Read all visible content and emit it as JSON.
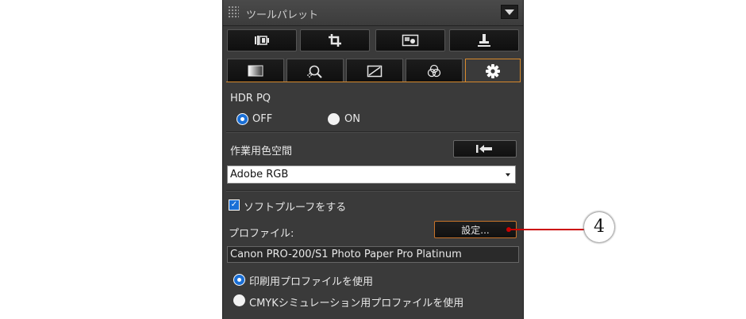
{
  "panel": {
    "title": "ツールパレット"
  },
  "toolbar": {
    "icons": [
      "lens-correction-icon",
      "crop-icon",
      "image-icon",
      "stamp-icon"
    ]
  },
  "tabs": {
    "icons": [
      "basic-adjust-icon",
      "noise-sharpness-icon",
      "tone-curve-icon",
      "color-adjust-icon",
      "settings-gear-icon"
    ],
    "active": 4
  },
  "hdr": {
    "label": "HDR PQ",
    "off_label": "OFF",
    "on_label": "ON",
    "selected": "OFF"
  },
  "color_space": {
    "label": "作業用色空間",
    "value": "Adobe RGB"
  },
  "soft_proof": {
    "checkbox_label": "ソフトプルーフをする",
    "checked": true,
    "profile_label": "プロファイル:",
    "settings_button": "設定...",
    "profile_value": "Canon PRO-200/S1 Photo Paper Pro Platinum",
    "print_option": "印刷用プロファイルを使用",
    "cmyk_option": "CMYKシミュレーション用プロファイルを使用",
    "selected_option": "print"
  },
  "callout": {
    "number": "4",
    "color": "#cc0000"
  },
  "colors": {
    "accent": "#d98a2c",
    "radio_selected": "#1a6fd6"
  }
}
